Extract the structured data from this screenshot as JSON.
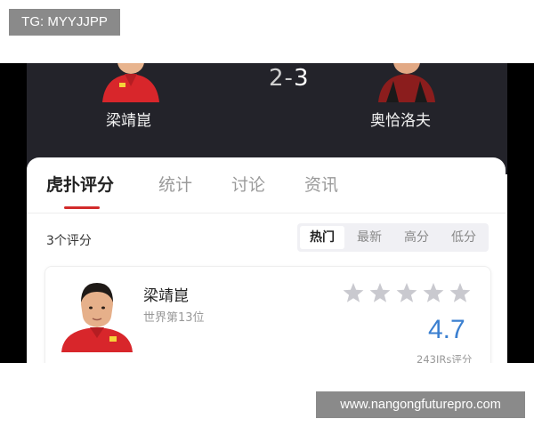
{
  "overlays": {
    "telegram_tag": "TG: MYYJJPP",
    "site_url": "www.nangongfuturepro.com"
  },
  "match": {
    "home_player": "梁靖崑",
    "away_player": "奥恰洛夫",
    "score_home": "2",
    "score_separator": "-",
    "score_away": "3"
  },
  "tabs": [
    "虎扑评分",
    "统计",
    "讨论",
    "资讯"
  ],
  "active_tab": "虎扑评分",
  "ratings": {
    "count_label": "3个评分",
    "sort_options": [
      "热门",
      "最新",
      "高分",
      "低分"
    ],
    "active_sort": "热门"
  },
  "player_card": {
    "name": "梁靖崑",
    "rank": "世界第13位",
    "stars_total": 5,
    "score": "4.7",
    "ratings_count_label": "243JRs评分"
  },
  "colors": {
    "header_bg": "#23232a",
    "accent_red": "#d22b2b",
    "score_blue": "#3a7fd0",
    "overlay_gray": "#8a8a8a"
  }
}
